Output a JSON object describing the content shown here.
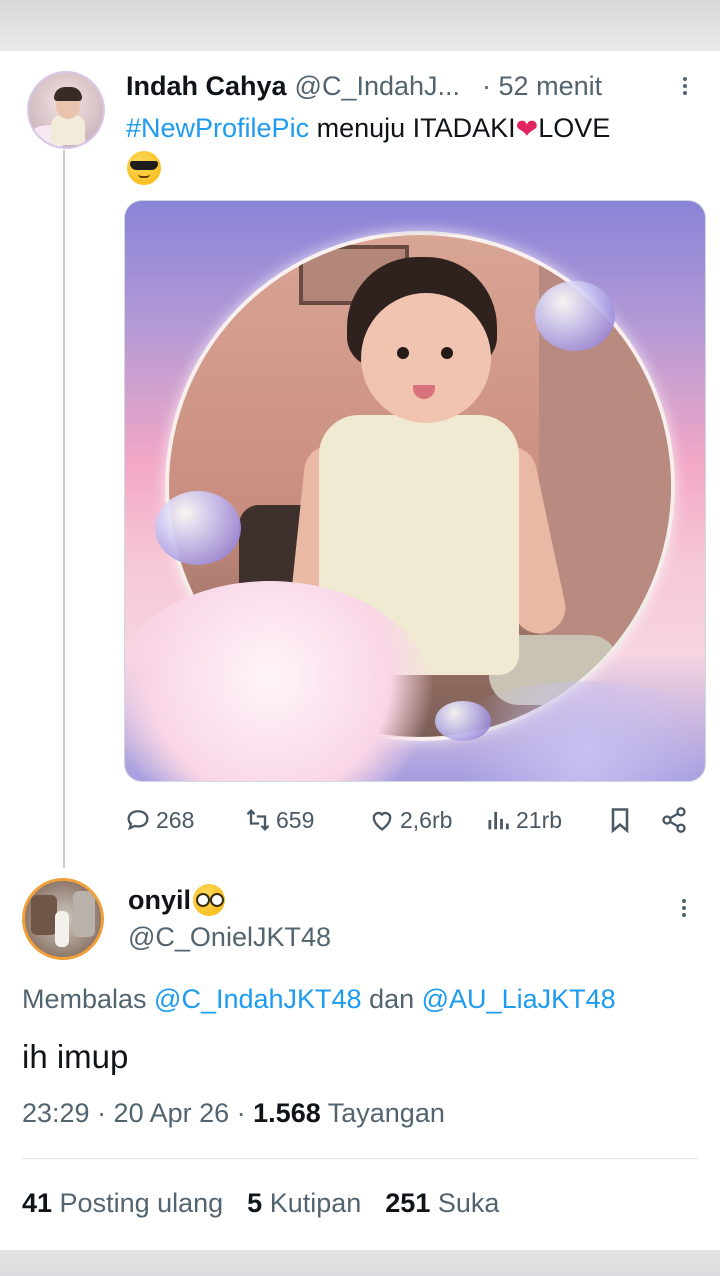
{
  "tweet": {
    "name": "Indah Cahya",
    "handle": "@C_IndahJ...",
    "time": "· 52 menit",
    "hashtag": "#NewProfilePic",
    "text_a": " menuju ITADAKI",
    "heart": "❤",
    "text_b": "LOVE",
    "emoji": "sunglasses-face"
  },
  "actions": {
    "replies": "268",
    "reposts": "659",
    "likes": "2,6rb",
    "views": "21rb"
  },
  "reply": {
    "name": "onyil",
    "emoji": "nerd-face",
    "handle": "@C_OnielJKT48",
    "replying_prefix": "Membalas ",
    "mention_1": "@C_IndahJKT48",
    "conj": " dan ",
    "mention_2": "@AU_LiaJKT48",
    "text": "ih imup",
    "time": "23:29 · 20 Apr 26 · ",
    "views_count": "1.568",
    "views_label": " Tayangan"
  },
  "stats": {
    "reposts_count": "41",
    "reposts_label": " Posting ulang",
    "quotes_count": "5",
    "quotes_label": " Kutipan",
    "likes_count": "251",
    "likes_label": " Suka"
  },
  "colors": {
    "link": "#1d9bf0",
    "secondary_text": "#536471",
    "primary_text": "#0f1419"
  }
}
